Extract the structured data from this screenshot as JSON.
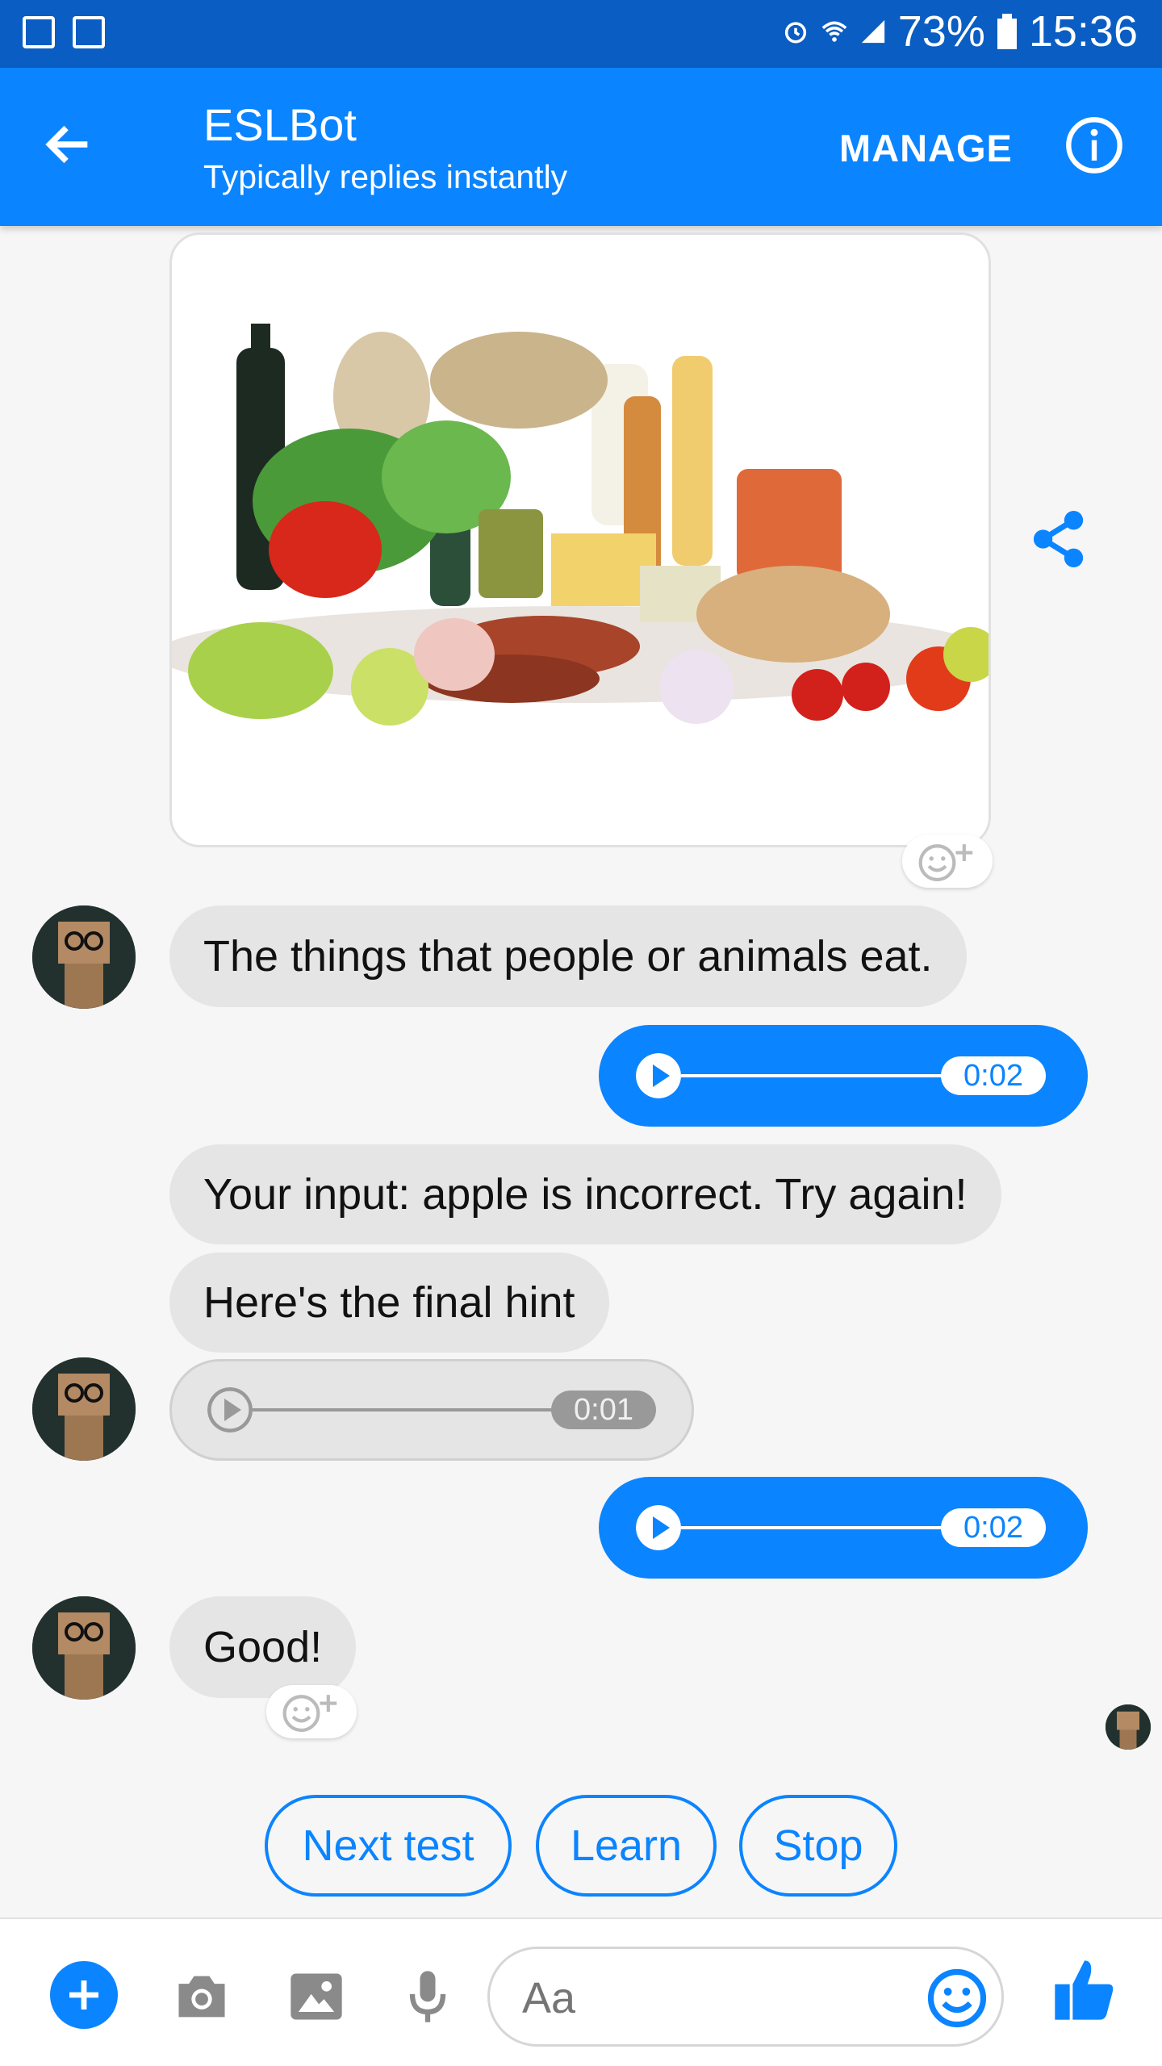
{
  "status_bar": {
    "battery": "73%",
    "time": "15:36"
  },
  "header": {
    "title": "ESLBot",
    "subtitle": "Typically replies instantly",
    "manage_label": "MANAGE"
  },
  "messages": {
    "bot_definition": "The things that people or animals eat.",
    "user_audio_1_duration": "0:02",
    "bot_incorrect": "Your input: apple is incorrect. Try again!",
    "bot_hint": "Here's the final hint",
    "bot_audio_duration": "0:01",
    "user_audio_2_duration": "0:02",
    "bot_good": "Good!"
  },
  "quick_replies": [
    "Next test",
    "Learn",
    "Stop"
  ],
  "composer": {
    "placeholder": "Aa"
  },
  "colors": {
    "brand": "#0b84ff",
    "status_bar": "#0a5dc2",
    "bubble_bot": "#e5e5e5"
  },
  "icons": [
    "back-arrow-icon",
    "info-icon",
    "share-icon",
    "add-reaction-icon",
    "play-icon",
    "plus-icon",
    "camera-icon",
    "gallery-icon",
    "microphone-icon",
    "emoji-icon",
    "thumbs-up-icon"
  ]
}
